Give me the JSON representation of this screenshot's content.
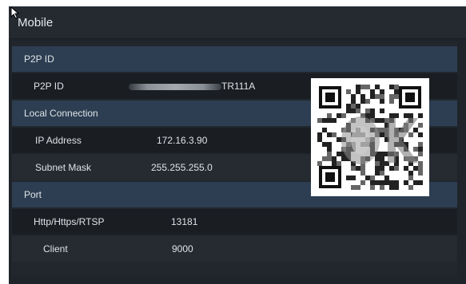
{
  "window": {
    "title": "Mobile"
  },
  "sections": {
    "p2p": {
      "header": "P2P ID",
      "id_label": "P2P ID",
      "id_value_suffix": "TR111A"
    },
    "local": {
      "header": "Local Connection",
      "ip_label": "IP Address",
      "ip_value": "172.16.3.90",
      "mask_label": "Subnet Mask",
      "mask_value": "255.255.255.0"
    },
    "port": {
      "header": "Port",
      "http_label": "Http/Https/RTSP",
      "http_value": "13181",
      "client_label": "Client",
      "client_value": "9000"
    }
  },
  "qr": {
    "icon": "qr-code-icon"
  },
  "colors": {
    "window_bg": "#1f242b",
    "section_bg": "#2d3e52",
    "row_dark": "#1a1e23",
    "text": "#dfe3e7"
  }
}
